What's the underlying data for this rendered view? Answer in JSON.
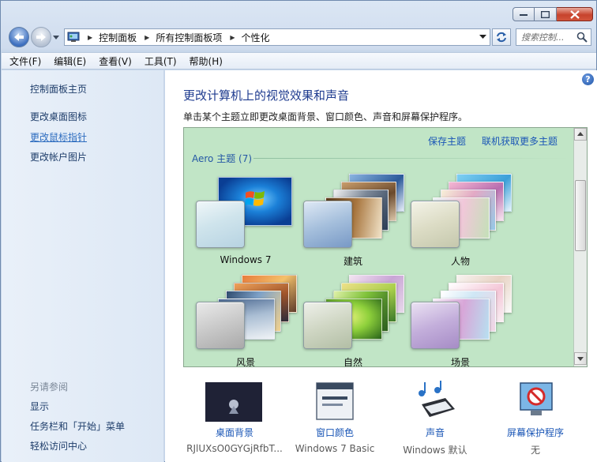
{
  "breadcrumb": [
    "控制面板",
    "所有控制面板项",
    "个性化"
  ],
  "search": {
    "placeholder": "搜索控制..."
  },
  "menu": [
    "文件(F)",
    "编辑(E)",
    "查看(V)",
    "工具(T)",
    "帮助(H)"
  ],
  "sidebar": {
    "links": [
      "控制面板主页",
      "更改桌面图标",
      "更改鼠标指针",
      "更改帐户图片"
    ],
    "see_also_label": "另请参阅",
    "see_also": [
      "显示",
      "任务栏和「开始」菜单",
      "轻松访问中心"
    ]
  },
  "main": {
    "title": "更改计算机上的视觉效果和声音",
    "description": "单击某个主题立即更改桌面背景、窗口颜色、声音和屏幕保护程序。",
    "save_theme": "保存主题",
    "get_more_online": "联机获取更多主题",
    "group_label": "Aero 主题 (7)",
    "themes": [
      "Windows 7",
      "建筑",
      "人物",
      "风景",
      "自然",
      "场景"
    ]
  },
  "bottom": [
    {
      "title": "桌面背景",
      "value": "RJlUXsO0GYGjRfbT..."
    },
    {
      "title": "窗口颜色",
      "value": "Windows 7 Basic"
    },
    {
      "title": "声音",
      "value": "Windows 默认"
    },
    {
      "title": "屏幕保护程序",
      "value": "无"
    }
  ],
  "help": {
    "label": "?"
  },
  "colors": {
    "accent": "#1e3b8f",
    "link": "#1a56b6",
    "theme_panel": "#c1e5c6"
  }
}
